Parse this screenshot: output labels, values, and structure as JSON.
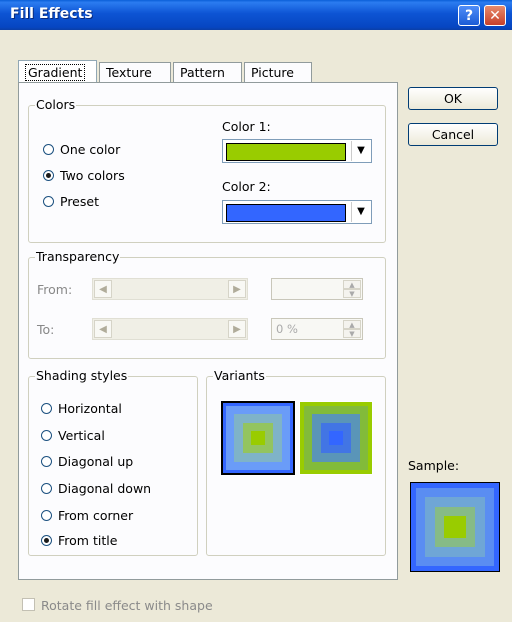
{
  "window": {
    "title": "Fill Effects",
    "help_glyph": "?",
    "close_glyph": "✕"
  },
  "tabs": [
    {
      "label": "Gradient",
      "active": true
    },
    {
      "label": "Texture",
      "active": false
    },
    {
      "label": "Pattern",
      "active": false
    },
    {
      "label": "Picture",
      "active": false
    }
  ],
  "buttons": {
    "ok": "OK",
    "cancel": "Cancel"
  },
  "colors": {
    "group_label": "Colors",
    "options": [
      {
        "label": "One color",
        "selected": false
      },
      {
        "label": "Two colors",
        "selected": true
      },
      {
        "label": "Preset",
        "selected": false
      }
    ],
    "color1_label": "Color 1:",
    "color1_value": "#99cc00",
    "color2_label": "Color 2:",
    "color2_value": "#3366ff"
  },
  "transparency": {
    "group_label": "Transparency",
    "from_label": "From:",
    "from_value": "",
    "to_label": "To:",
    "to_value": "0 %"
  },
  "shading": {
    "group_label": "Shading styles",
    "options": [
      {
        "label": "Horizontal",
        "selected": false
      },
      {
        "label": "Vertical",
        "selected": false
      },
      {
        "label": "Diagonal up",
        "selected": false
      },
      {
        "label": "Diagonal down",
        "selected": false
      },
      {
        "label": "From corner",
        "selected": false
      },
      {
        "label": "From title",
        "selected": true
      }
    ]
  },
  "variants": {
    "group_label": "Variants"
  },
  "sample": {
    "label": "Sample:"
  },
  "rotate_checkbox": {
    "label": "Rotate fill effect with shape",
    "checked": false,
    "enabled": false
  },
  "icons": {
    "dropdown": "▼",
    "left_arrow": "◀",
    "right_arrow": "▶",
    "up_arrow": "▲",
    "down_arrow": "▼"
  }
}
